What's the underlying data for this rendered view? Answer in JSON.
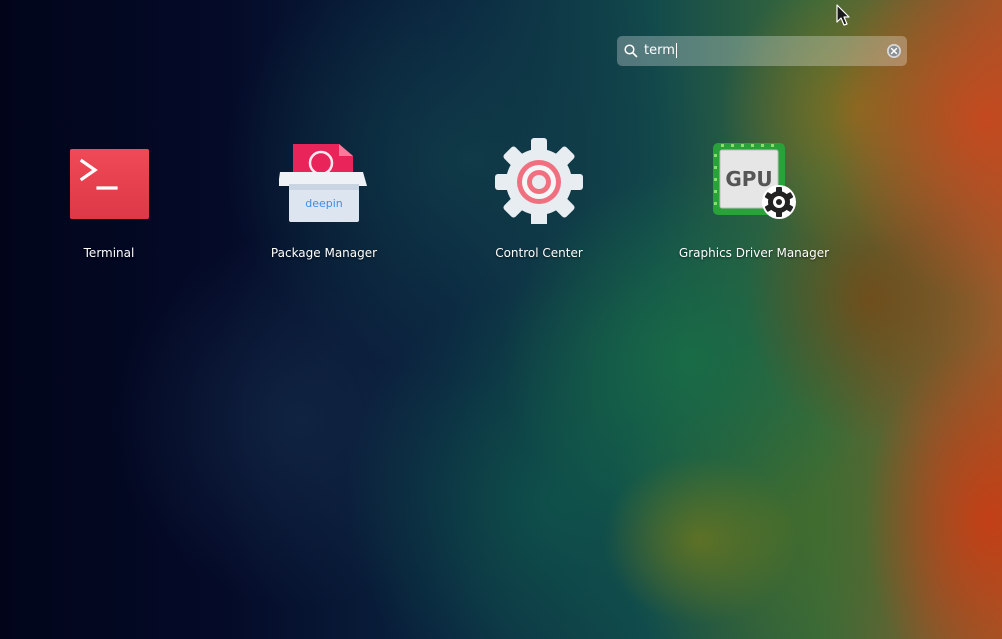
{
  "search": {
    "query": "term",
    "icon": "search-icon",
    "clear_icon": "clear-icon"
  },
  "results": [
    {
      "label": "Terminal",
      "icon": "terminal-icon",
      "accent": "#e8404e"
    },
    {
      "label": "Package Manager",
      "icon": "package-manager-icon",
      "box_text": "deepin",
      "accent": "#e8245a"
    },
    {
      "label": "Control Center",
      "icon": "control-center-icon",
      "accent": "#f07080"
    },
    {
      "label": "Graphics Driver Manager",
      "icon": "gpu-icon",
      "chip_text": "GPU",
      "accent": "#2aa23a"
    }
  ],
  "cursor": {
    "icon": "mouse-pointer-icon"
  }
}
